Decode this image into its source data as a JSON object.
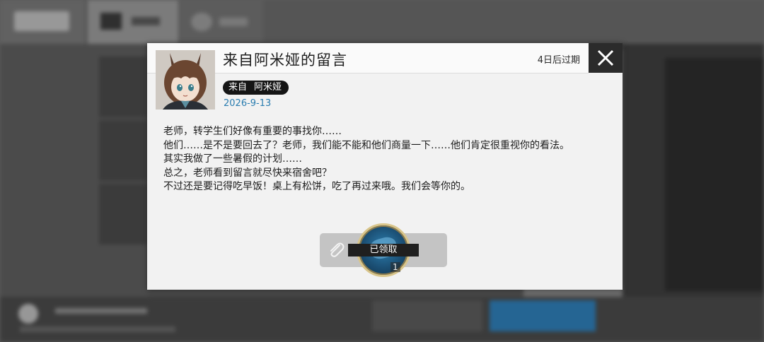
{
  "mail": {
    "title": "来自阿米娅的留言",
    "expires": "4日后过期",
    "sender_label": "来自",
    "sender_name": "阿米娅",
    "date": "2026-9-13",
    "message_lines": [
      "老师，转学生们好像有重要的事找你……",
      "他们……是不是要回去了？老师，我们能不能和他们商量一下……他们肯定很重视你的看法。",
      "其实我做了一些暑假的计划……",
      "总之，老师看到留言就尽快来宿舍吧？",
      "不过还是要记得吃早饭！桌上有松饼，吃了再过来哦。我们会等你的。"
    ]
  },
  "attachment": {
    "status": "已领取",
    "count": "1"
  },
  "icons": {
    "close": "close-icon",
    "attachment": "paperclip-icon"
  },
  "colors": {
    "date": "#2a7db0",
    "close_bg": "#2b2b2b",
    "tag_bg": "#151515"
  }
}
